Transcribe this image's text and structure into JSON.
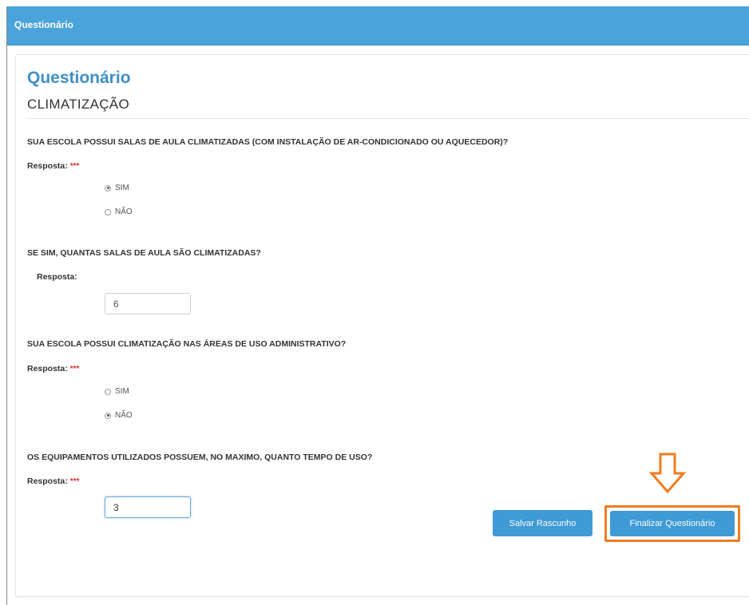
{
  "window": {
    "title": "Questionário"
  },
  "panel": {
    "title": "Questionário",
    "section": "CLIMATIZAÇÃO"
  },
  "questions": [
    {
      "text": "SUA ESCOLA POSSUI SALAS DE AULA CLIMATIZADAS (COM INSTALAÇÃO DE AR-CONDICIONADO OU AQUECEDOR)?",
      "response_label": "Resposta:",
      "required_mark": "***",
      "options": [
        "SIM",
        "NÃO"
      ],
      "selected": "SIM"
    },
    {
      "text": "SE SIM, QUANTAS SALAS DE AULA SÃO CLIMATIZADAS?",
      "response_label": "Resposta:",
      "value": "6"
    },
    {
      "text": "SUA ESCOLA POSSUI CLIMATIZAÇÃO NAS ÁREAS DE USO ADMINISTRATIVO?",
      "response_label": "Resposta:",
      "required_mark": "***",
      "options": [
        "SIM",
        "NÃO"
      ],
      "selected": "NÃO"
    },
    {
      "text": "OS EQUIPAMENTOS UTILIZADOS POSSUEM, NO MAXIMO, QUANTO TEMPO DE USO?",
      "response_label": "Resposta:",
      "required_mark": "***",
      "value": "3"
    }
  ],
  "buttons": {
    "save": "Salvar Rascunho",
    "finish": "Finalizar Questionário"
  },
  "colors": {
    "titlebar": "#4aa3da",
    "accent": "#3f9ad6",
    "highlight": "#ef7c1f",
    "required": "#e0312f"
  },
  "icons": {
    "annotation": "arrow-down-icon"
  }
}
